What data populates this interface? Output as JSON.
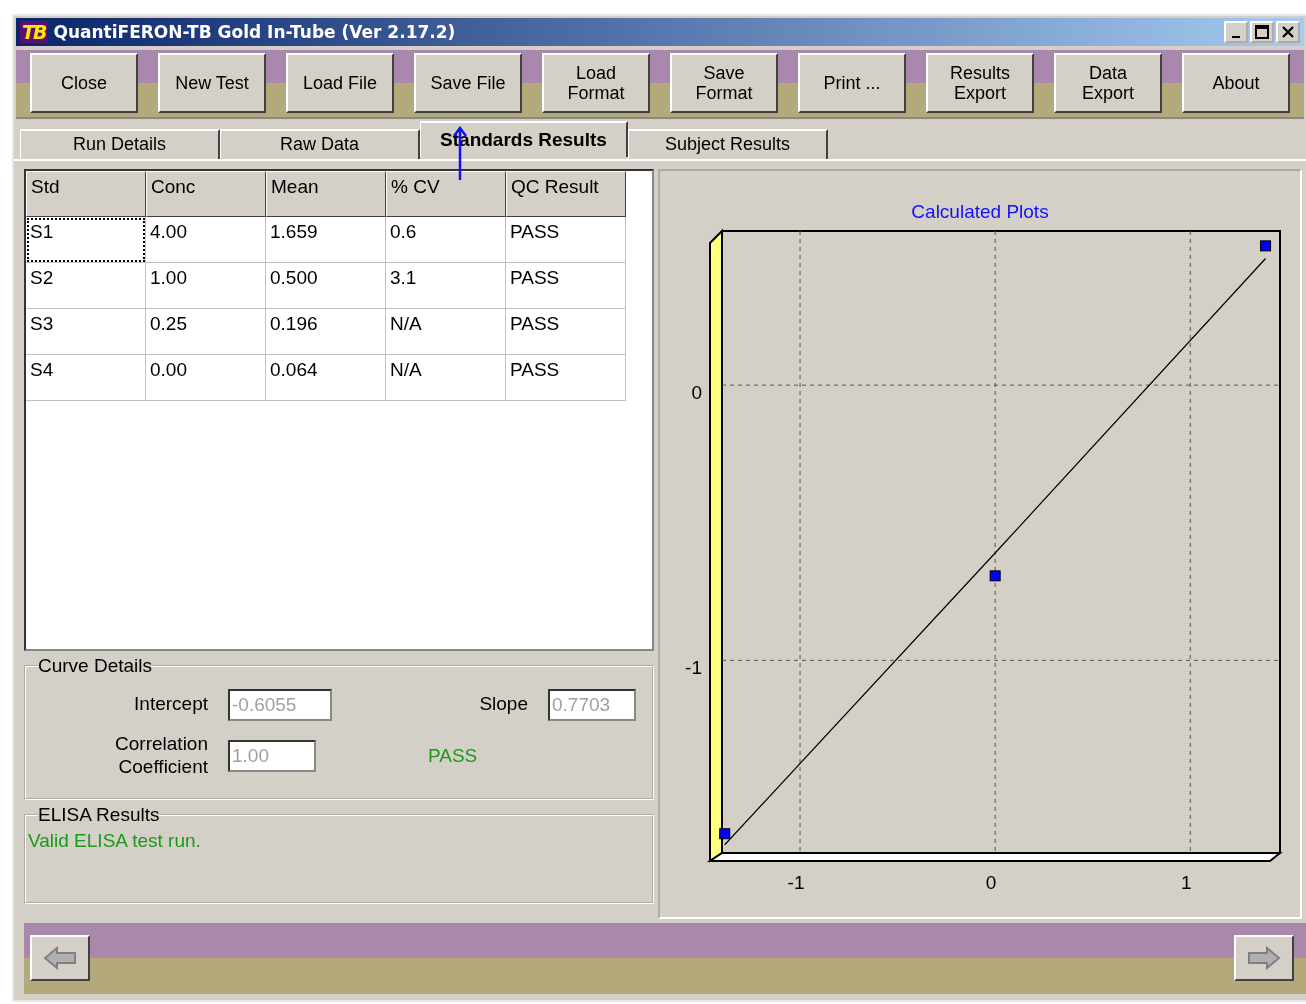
{
  "window": {
    "title": "QuantiFERON-TB Gold In-Tube (Ver 2.17.2)",
    "logo": "TB"
  },
  "toolbar": [
    {
      "lines": [
        "Close"
      ]
    },
    {
      "lines": [
        "New Test"
      ]
    },
    {
      "lines": [
        "Load File"
      ]
    },
    {
      "lines": [
        "Save File"
      ]
    },
    {
      "lines": [
        "Load",
        "Format"
      ]
    },
    {
      "lines": [
        "Save",
        "Format"
      ]
    },
    {
      "lines": [
        "Print ..."
      ]
    },
    {
      "lines": [
        "Results",
        "Export"
      ]
    },
    {
      "lines": [
        "Data",
        "Export"
      ]
    },
    {
      "lines": [
        "About"
      ]
    }
  ],
  "tabs": [
    {
      "label": "Run Details",
      "selected": false
    },
    {
      "label": "Raw Data",
      "selected": false
    },
    {
      "label": "Standards Results",
      "selected": true
    },
    {
      "label": "Subject Results",
      "selected": false
    }
  ],
  "table": {
    "columns": [
      "Std",
      "Conc",
      "Mean",
      "% CV",
      "QC Result"
    ],
    "rows": [
      {
        "cells": [
          "S1",
          "4.00",
          "1.659",
          "0.6",
          "PASS"
        ],
        "focused": true
      },
      {
        "cells": [
          "S2",
          "1.00",
          "0.500",
          "3.1",
          "PASS"
        ],
        "focused": false
      },
      {
        "cells": [
          "S3",
          "0.25",
          "0.196",
          "N/A",
          "PASS"
        ],
        "focused": false
      },
      {
        "cells": [
          "S4",
          "0.00",
          "0.064",
          "N/A",
          "PASS"
        ],
        "focused": false
      }
    ]
  },
  "curve_details": {
    "title": "Curve Details",
    "intercept": {
      "label": "Intercept",
      "value": "-0.6055",
      "disabled": true
    },
    "slope": {
      "label": "Slope",
      "value": "0.7703",
      "disabled": true
    },
    "correlation": {
      "label": [
        "Correlation",
        "Coefficient"
      ],
      "value": "1.00",
      "disabled": true
    },
    "status": "PASS"
  },
  "elisa_results": {
    "title": "ELISA Results",
    "message": "Valid ELISA test run."
  },
  "chart": {
    "chart_data": {
      "type": "scatter",
      "title": "Calculated Plots",
      "x": [
        1.386,
        0,
        -1.386
      ],
      "series": [
        {
          "color": "#0000ff",
          "values": [
            0.506,
            -0.693,
            -1.63
          ]
        },
        {
          "type": "line",
          "color": "#000000",
          "values": [
            0.46,
            -0.61,
            -1.67
          ]
        }
      ],
      "xlim": [
        -1.4,
        1.46
      ],
      "ylim": [
        -1.7,
        0.56
      ],
      "xticks": [
        -1,
        0,
        1
      ],
      "yticks": [
        0,
        -1
      ],
      "grid": true
    }
  }
}
